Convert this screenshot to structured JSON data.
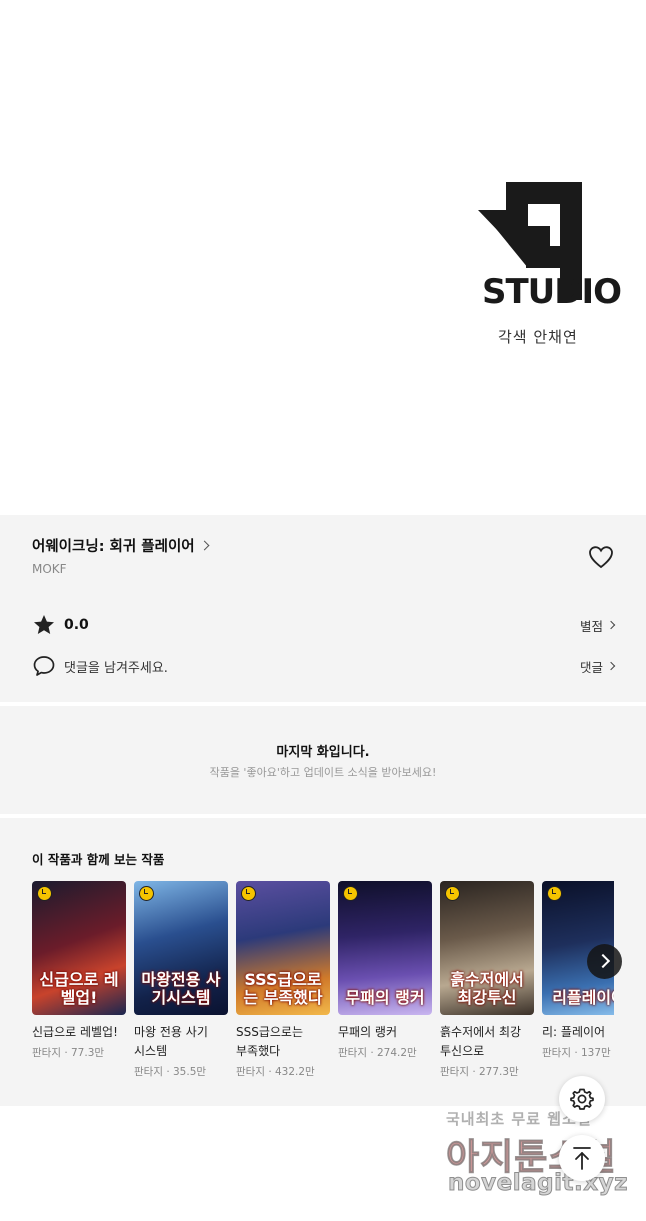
{
  "comic_image": {
    "studio_name": "STUDIO",
    "credit": "각색 안채연"
  },
  "work": {
    "title": "어웨이크닝: 회귀 플레이어",
    "author": "MOKF",
    "rating": "0.0",
    "rating_link": "별점",
    "comment_placeholder": "댓글을 남겨주세요.",
    "comment_link": "댓글"
  },
  "last_episode": {
    "title": "마지막 화입니다.",
    "subtitle": "작품을 '좋아요'하고 업데이트 소식을 받아보세요!"
  },
  "recommendations": {
    "heading": "이 작품과 함께 보는 작품",
    "items": [
      {
        "name": "신급으로 레벨업!",
        "meta": "판타지 · 77.3만",
        "cover_text": "신급으로 레벨업!",
        "cover_color": "#3a1a2e"
      },
      {
        "name": "마왕 전용 사기 시스템",
        "meta": "판타지 · 35.5만",
        "cover_text": "마왕전용 사기시스템",
        "cover_color": "#1e3a6e"
      },
      {
        "name": "SSS급으로는 부족했다",
        "meta": "판타지 · 432.2만",
        "cover_text": "SSS급으로는 부족했다",
        "cover_color": "#3b2f6a"
      },
      {
        "name": "무패의 랭커",
        "meta": "판타지 · 274.2만",
        "cover_text": "무패의 랭커",
        "cover_color": "#2a2148"
      },
      {
        "name": "흙수저에서 최강 투신으로",
        "meta": "판타지 · 277.3만",
        "cover_text": "흙수저에서 최강투신",
        "cover_color": "#4a3a30"
      },
      {
        "name": "리: 플레이어",
        "meta": "판타지 · 137만",
        "cover_text": "리플레이어",
        "cover_color": "#18233f"
      }
    ]
  },
  "watermark": {
    "line1": "국내최초 무료 웹소설",
    "line2": "아지툰소설",
    "line3": "novelagit.xyz"
  }
}
